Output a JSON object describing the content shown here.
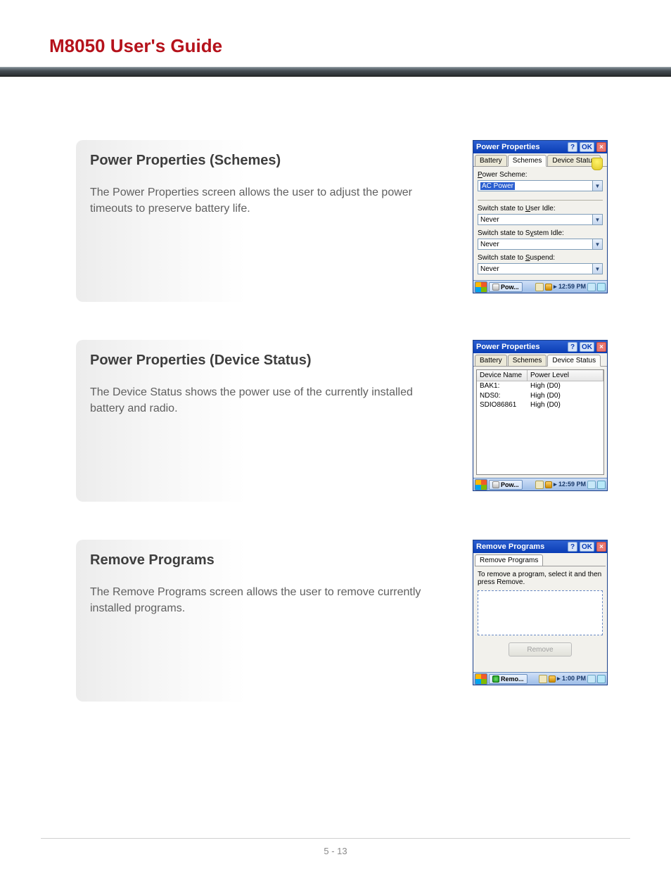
{
  "header": {
    "title": "M8050 User's Guide"
  },
  "sections": [
    {
      "title": "Power Properties (Schemes)",
      "body": "The Power Properties screen allows the user to adjust the power timeouts to preserve battery life."
    },
    {
      "title": "Power Properties (Device Status)",
      "body": "The Device Status shows the power use of the currently installed battery and radio."
    },
    {
      "title": "Remove Programs",
      "body": "The Remove Programs screen allows the user to remove currently installed programs."
    }
  ],
  "screenshots": {
    "schemes": {
      "window_title": "Power Properties",
      "tabs": [
        "Battery",
        "Schemes",
        "Device Status"
      ],
      "active_tab": "Schemes",
      "scheme_label": "Power Scheme:",
      "scheme_value": "AC Power",
      "fields": [
        {
          "label": "Switch state to User Idle:",
          "value": "Never"
        },
        {
          "label": "Switch state to System Idle:",
          "value": "Never"
        },
        {
          "label": "Switch state to Suspend:",
          "value": "Never"
        }
      ],
      "taskbar_button": "Pow...",
      "time": "12:59 PM"
    },
    "devstatus": {
      "window_title": "Power Properties",
      "tabs": [
        "Battery",
        "Schemes",
        "Device Status"
      ],
      "active_tab": "Device Status",
      "columns": [
        "Device Name",
        "Power Level"
      ],
      "rows": [
        {
          "name": "BAK1:",
          "level": "High   (D0)"
        },
        {
          "name": "NDS0:",
          "level": "High   (D0)"
        },
        {
          "name": "SDIO86861",
          "level": "High   (D0)"
        }
      ],
      "taskbar_button": "Pow...",
      "time": "12:59 PM"
    },
    "remove": {
      "window_title": "Remove Programs",
      "tab": "Remove Programs",
      "instruction": "To remove a program, select it and then press Remove.",
      "button": "Remove",
      "taskbar_button": "Remo...",
      "time": "1:00 PM"
    }
  },
  "win_buttons": {
    "help": "?",
    "ok": "OK",
    "close": "×"
  },
  "footer": {
    "page": "5 - 13"
  }
}
